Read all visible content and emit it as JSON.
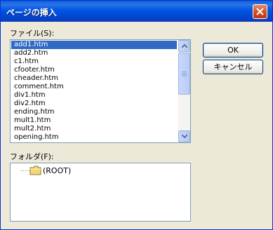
{
  "window": {
    "title": "ページの挿入"
  },
  "files": {
    "label": "ファイル(S):",
    "items": [
      "add1.htm",
      "add2.htm",
      "c1.htm",
      "cfooter.htm",
      "cheader.htm",
      "comment.htm",
      "div1.htm",
      "div2.htm",
      "ending.htm",
      "mult1.htm",
      "mult2.htm",
      "opening.htm"
    ],
    "selected": "add1.htm"
  },
  "folders": {
    "label": "フォルダ(F):",
    "root": "(ROOT)"
  },
  "buttons": {
    "ok": "OK",
    "cancel": "キャンセル"
  },
  "colors": {
    "selection": "#316ac5",
    "title_bar": "#0055e5"
  }
}
